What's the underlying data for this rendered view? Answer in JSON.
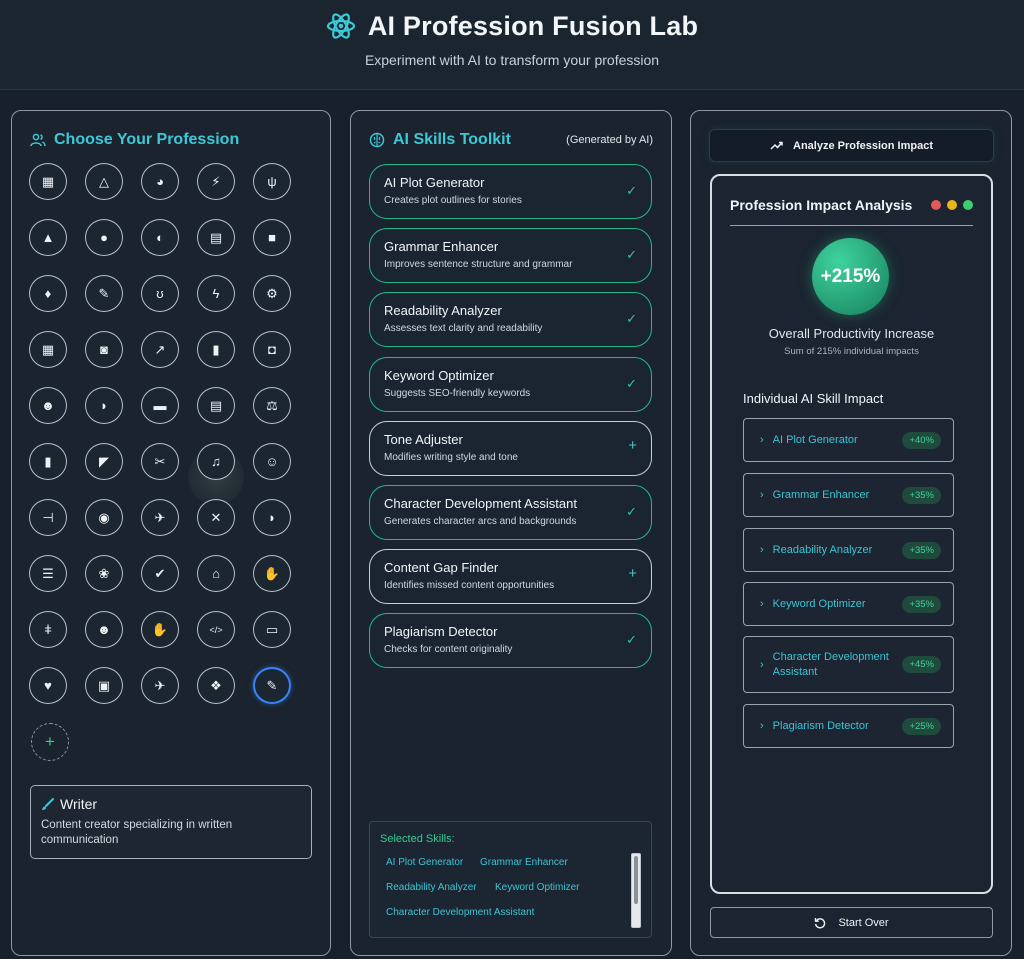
{
  "header": {
    "title": "AI Profession Fusion Lab",
    "subtitle": "Experiment with AI to transform your profession"
  },
  "profession_panel": {
    "title": "Choose Your Profession",
    "professions": [
      {
        "icon": "calculator-icon",
        "glyph": "▦"
      },
      {
        "icon": "drafting-compass-icon",
        "glyph": "△"
      },
      {
        "icon": "palette-icon",
        "glyph": "◕"
      },
      {
        "icon": "running-icon",
        "glyph": "⚡"
      },
      {
        "icon": "utensils-icon",
        "glyph": "ψ"
      },
      {
        "icon": "graduation-cap-icon",
        "glyph": "▲"
      },
      {
        "icon": "user-tie-icon",
        "glyph": "●"
      },
      {
        "icon": "headset-icon",
        "glyph": "◐"
      },
      {
        "icon": "chart-bar-icon",
        "glyph": "▤"
      },
      {
        "icon": "truck-icon",
        "glyph": "■"
      },
      {
        "icon": "tooth-icon",
        "glyph": "♦"
      },
      {
        "icon": "paintbrush-icon",
        "glyph": "✎"
      },
      {
        "icon": "stethoscope-icon",
        "glyph": "ʊ"
      },
      {
        "icon": "bolt-icon",
        "glyph": "ϟ"
      },
      {
        "icon": "cogs-icon",
        "glyph": "⚙"
      },
      {
        "icon": "calendar-icon",
        "glyph": "▦"
      },
      {
        "icon": "tractor-icon",
        "glyph": "◙"
      },
      {
        "icon": "chart-line-icon",
        "glyph": "↗"
      },
      {
        "icon": "fire-extinguisher-icon",
        "glyph": "▮"
      },
      {
        "icon": "gamepad-icon",
        "glyph": "◘"
      },
      {
        "icon": "users-icon",
        "glyph": "☻"
      },
      {
        "icon": "shield-icon",
        "glyph": "◗"
      },
      {
        "icon": "couch-icon",
        "glyph": "▬"
      },
      {
        "icon": "newspaper-icon",
        "glyph": "▤"
      },
      {
        "icon": "balance-scale-icon",
        "glyph": "⚖"
      },
      {
        "icon": "book-icon",
        "glyph": "▮"
      },
      {
        "icon": "bullhorn-icon",
        "glyph": "◤"
      },
      {
        "icon": "wrench-icon",
        "glyph": "✂"
      },
      {
        "icon": "music-icon",
        "glyph": "♫"
      },
      {
        "icon": "user-nurse-icon",
        "glyph": "☺"
      },
      {
        "icon": "dumbbell-icon",
        "glyph": "⊣"
      },
      {
        "icon": "camera-icon",
        "glyph": "◉"
      },
      {
        "icon": "plane-icon",
        "glyph": "✈"
      },
      {
        "icon": "tools-icon",
        "glyph": "✕"
      },
      {
        "icon": "shield-alt-icon",
        "glyph": "◗"
      },
      {
        "icon": "tasks-icon",
        "glyph": "☰"
      },
      {
        "icon": "brain-icon",
        "glyph": "❀"
      },
      {
        "icon": "check-circle-icon",
        "glyph": "✔"
      },
      {
        "icon": "home-icon",
        "glyph": "⌂"
      },
      {
        "icon": "handshake-icon",
        "glyph": "✋"
      },
      {
        "icon": "microscope-icon",
        "glyph": "ǂ"
      },
      {
        "icon": "user-cog-icon",
        "glyph": "☻"
      },
      {
        "icon": "hands-helping-icon",
        "glyph": "✋"
      },
      {
        "icon": "code-icon",
        "glyph": "</>"
      },
      {
        "icon": "chalkboard-teacher-icon",
        "glyph": "▭"
      },
      {
        "icon": "heart-icon",
        "glyph": "♥"
      },
      {
        "icon": "id-card-icon",
        "glyph": "▣"
      },
      {
        "icon": "plane-departure-icon",
        "glyph": "✈"
      },
      {
        "icon": "paw-icon",
        "glyph": "❖"
      },
      {
        "icon": "pen-brush-icon",
        "glyph": "✎"
      }
    ],
    "add_label": "+",
    "selected_profession": {
      "name": "Writer",
      "description": "Content creator specializing in written communication"
    }
  },
  "skills_panel": {
    "title": "AI Skills Toolkit",
    "note": "(Generated by AI)",
    "skills": [
      {
        "name": "AI Plot Generator",
        "description": "Creates plot outlines for stories",
        "selected": true,
        "mark": "✓"
      },
      {
        "name": "Grammar Enhancer",
        "description": "Improves sentence structure and grammar",
        "selected": true,
        "mark": "✓"
      },
      {
        "name": "Readability Analyzer",
        "description": "Assesses text clarity and readability",
        "selected": true,
        "mark": "✓"
      },
      {
        "name": "Keyword Optimizer",
        "description": "Suggests SEO-friendly keywords",
        "selected": true,
        "mark": "✓"
      },
      {
        "name": "Tone Adjuster",
        "description": "Modifies writing style and tone",
        "selected": false,
        "mark": "+"
      },
      {
        "name": "Character Development Assistant",
        "description": "Generates character arcs and backgrounds",
        "selected": true,
        "mark": "✓"
      },
      {
        "name": "Content Gap Finder",
        "description": "Identifies missed content opportunities",
        "selected": false,
        "mark": "+"
      },
      {
        "name": "Plagiarism Detector",
        "description": "Checks for content originality",
        "selected": true,
        "mark": "✓"
      }
    ],
    "selected_label": "Selected Skills:",
    "selected_chips": [
      "AI Plot Generator",
      "Grammar Enhancer",
      "Readability Analyzer",
      "Keyword Optimizer",
      "Character Development Assistant"
    ]
  },
  "analysis_panel": {
    "analyze_button": "Analyze Profession Impact",
    "title": "Profession Impact Analysis",
    "dot_colors": [
      "#e05a5a",
      "#e8b51c",
      "#3ccf6e"
    ],
    "total_impact": "+215%",
    "total_label": "Overall Productivity Increase",
    "total_sub": "Sum of 215% individual impacts",
    "individual_title": "Individual AI Skill Impact",
    "impacts": [
      {
        "name": "AI Plot Generator",
        "value": "+40%"
      },
      {
        "name": "Grammar Enhancer",
        "value": "+35%"
      },
      {
        "name": "Readability Analyzer",
        "value": "+35%"
      },
      {
        "name": "Keyword Optimizer",
        "value": "+35%"
      },
      {
        "name": "Character Development Assistant",
        "value": "+45%"
      },
      {
        "name": "Plagiarism Detector",
        "value": "+25%"
      }
    ],
    "start_over": "Start Over"
  },
  "colors": {
    "accent_cyan": "#3dc8d8",
    "accent_green": "#35c98f",
    "background": "#17202b"
  }
}
